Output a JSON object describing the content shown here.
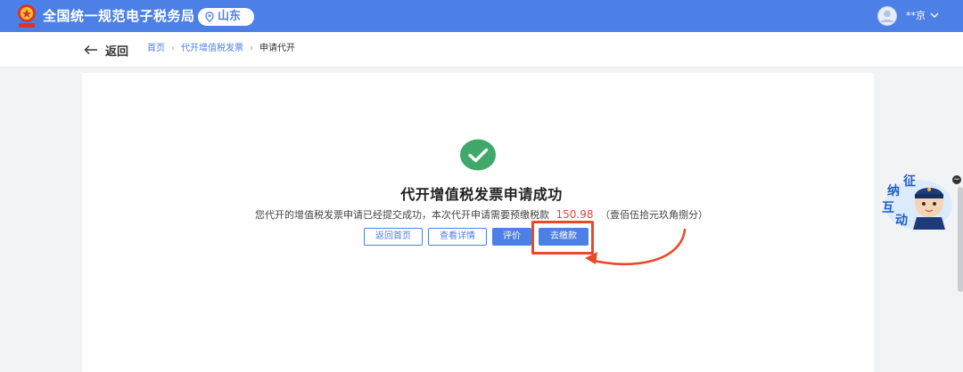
{
  "header": {
    "site_title": "全国统一规范电子税务局",
    "region": "山东",
    "username": "**京",
    "accent_color": "#4d80e6"
  },
  "nav": {
    "back_label": "返回",
    "breadcrumb": [
      "首页",
      "代开增值税发票",
      "申请代开"
    ]
  },
  "result": {
    "title": "代开增值税发票申请成功",
    "description": "您代开的增值税发票申请已经提交成功，本次代开申请需要预缴税款",
    "amount": "150.98",
    "amount_words": "（壹佰伍拾元玖角捌分）",
    "amount_color": "#e8453c"
  },
  "actions": {
    "home": "返回首页",
    "details": "查看详情",
    "rate": "评价",
    "pay": "去缴款"
  },
  "mascot": {
    "label_1": "征",
    "label_2": "纳",
    "label_3": "互",
    "label_4": "动"
  },
  "annotation": {
    "highlight_color": "#e84a27"
  }
}
